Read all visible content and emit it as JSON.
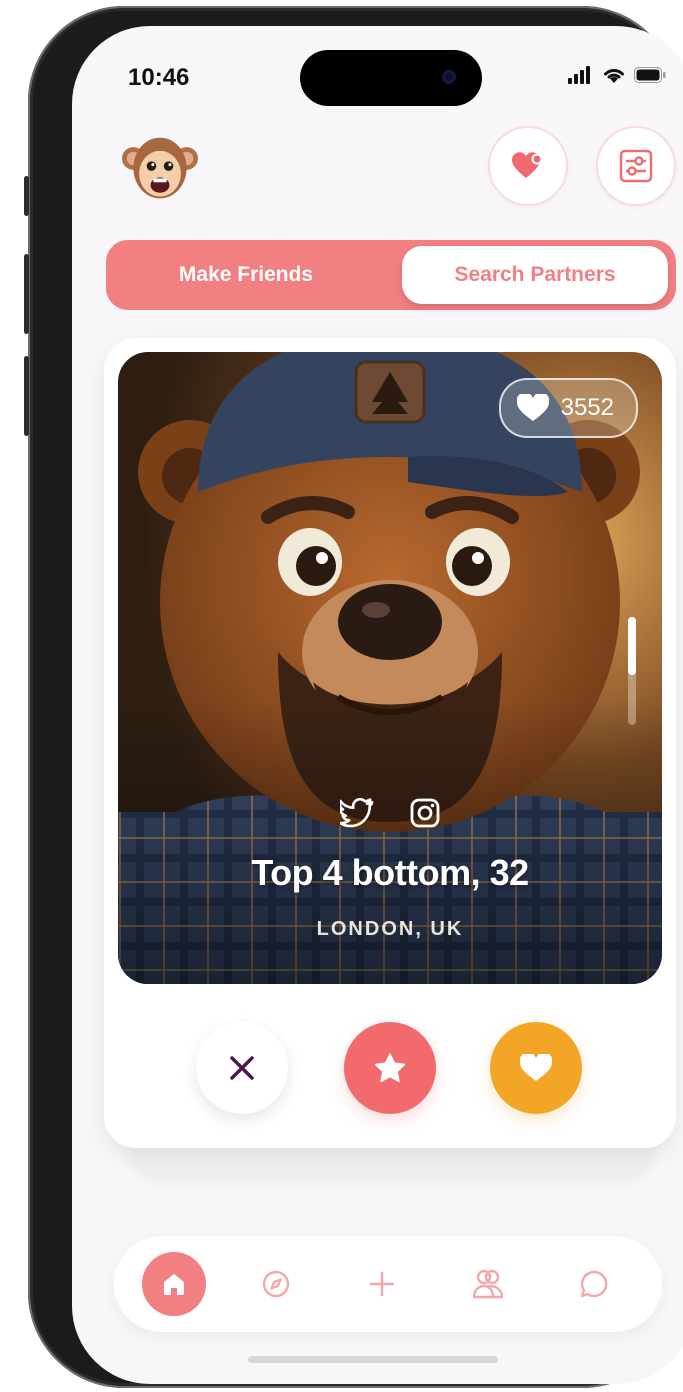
{
  "status_bar": {
    "time": "10:46"
  },
  "header": {
    "avatar_icon": "monkey-avatar",
    "likes_button_icon": "heart-plus-icon",
    "filter_button_icon": "sliders-icon"
  },
  "mode_toggle": {
    "options": [
      "Make Friends",
      "Search Partners"
    ],
    "selected": "Search Partners"
  },
  "profile_card": {
    "likes_count": "3552",
    "name_age": "Top 4 bottom, 32",
    "location": "LONDON, UK",
    "social_icons": [
      "twitter-icon",
      "instagram-icon"
    ],
    "photo_scroll_position": 0.25
  },
  "actions": [
    {
      "name": "dislike",
      "icon": "close-icon",
      "color": "#ffffff"
    },
    {
      "name": "superlike",
      "icon": "star-icon",
      "color": "#f26a6c"
    },
    {
      "name": "like",
      "icon": "heart-icon",
      "color": "#f3a526"
    }
  ],
  "tab_bar": {
    "items": [
      "home-icon",
      "compass-icon",
      "plus-icon",
      "people-icon",
      "chat-icon"
    ],
    "active": "home-icon"
  },
  "colors": {
    "accent": "#f27f82",
    "like": "#f3a526",
    "superlike": "#f26a6c",
    "dislike_icon": "#4a1a4d"
  }
}
